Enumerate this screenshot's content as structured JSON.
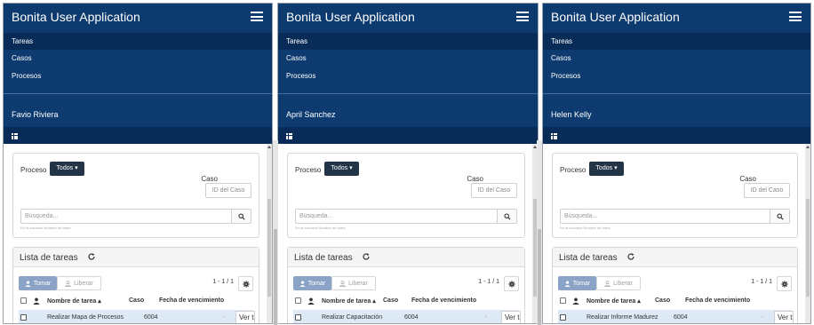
{
  "panels": [
    {
      "app_title": "Bonita User Application",
      "menu": [
        "Tareas",
        "Casos",
        "Procesos"
      ],
      "user_name": "Favio Riviera",
      "filter": {
        "proceso_label": "Proceso",
        "todos_label": "Todos",
        "caso_label": "Caso",
        "caso_placeholder": "ID del Caso",
        "search_placeholder": "Búsqueda...",
        "search_hint": "En la columna Nombre de tarea"
      },
      "tasks": {
        "title": "Lista de tareas",
        "take_label": "Tomar",
        "release_label": "Liberar",
        "pager": "1 - 1 / 1",
        "columns": [
          "Nombre de tarea",
          "Caso",
          "Fecha de vencimiento"
        ],
        "row": {
          "name": "Realizar Mapa de Procesos",
          "case": "6004",
          "due": "-",
          "action": "Ver tarea"
        }
      }
    },
    {
      "app_title": "Bonita User Application",
      "menu": [
        "Tareas",
        "Casos",
        "Procesos"
      ],
      "user_name": "April Sanchez",
      "filter": {
        "proceso_label": "Proceso",
        "todos_label": "Todos",
        "caso_label": "Caso",
        "caso_placeholder": "ID del Caso",
        "search_placeholder": "Búsqueda...",
        "search_hint": "En la columna Nombre de tarea"
      },
      "tasks": {
        "title": "Lista de tareas",
        "take_label": "Tomar",
        "release_label": "Liberar",
        "pager": "1 - 1 / 1",
        "columns": [
          "Nombre de tarea",
          "Caso",
          "Fecha de vencimiento"
        ],
        "row": {
          "name": "Realizar Capacitación",
          "case": "6004",
          "due": "-",
          "action": "Ver tarea"
        }
      }
    },
    {
      "app_title": "Bonita User Application",
      "menu": [
        "Tareas",
        "Casos",
        "Procesos"
      ],
      "user_name": "Helen Kelly",
      "filter": {
        "proceso_label": "Proceso",
        "todos_label": "Todos",
        "caso_label": "Caso",
        "caso_placeholder": "ID del Caso",
        "search_placeholder": "Búsqueda...",
        "search_hint": "En la columna Nombre de tarea"
      },
      "tasks": {
        "title": "Lista de tareas",
        "take_label": "Tomar",
        "release_label": "Liberar",
        "pager": "1 - 1 / 1",
        "columns": [
          "Nombre de tarea",
          "Caso",
          "Fecha de vencimiento"
        ],
        "row": {
          "name": "Realizar Informe Madurez",
          "case": "6004",
          "due": "-",
          "action": "Ver tarea"
        }
      }
    }
  ],
  "colors": {
    "navbar": "#0d3a6f",
    "navbar_active": "#082c57",
    "primary_button": "#243447",
    "selected_row": "#dde9f5"
  }
}
